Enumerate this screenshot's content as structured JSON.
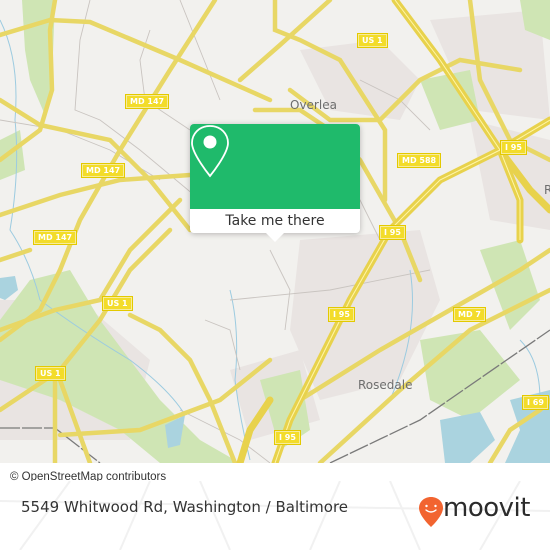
{
  "map": {
    "place_labels": [
      {
        "name": "Overlea"
      },
      {
        "name": "Rosedale"
      },
      {
        "name": "R"
      }
    ],
    "road_shields": [
      {
        "label": "US 1"
      },
      {
        "label": "MD 147"
      },
      {
        "label": "MD 147"
      },
      {
        "label": "MD 147"
      },
      {
        "label": "MD 588"
      },
      {
        "label": "I 95"
      },
      {
        "label": "I 95"
      },
      {
        "label": "I 95"
      },
      {
        "label": "I 95"
      },
      {
        "label": "US 1"
      },
      {
        "label": "US 1"
      },
      {
        "label": "MD 7"
      },
      {
        "label": "I 69"
      },
      {
        "label": "I 95"
      }
    ],
    "attribution": "© OpenStreetMap contributors"
  },
  "popup": {
    "button_label": "Take me there",
    "icon": "map-pin-icon",
    "accent_color": "#1fba6b"
  },
  "footer": {
    "address": "5549 Whitwood Rd, Washington / Baltimore",
    "brand": "moovit",
    "brand_color": "#f26430"
  }
}
